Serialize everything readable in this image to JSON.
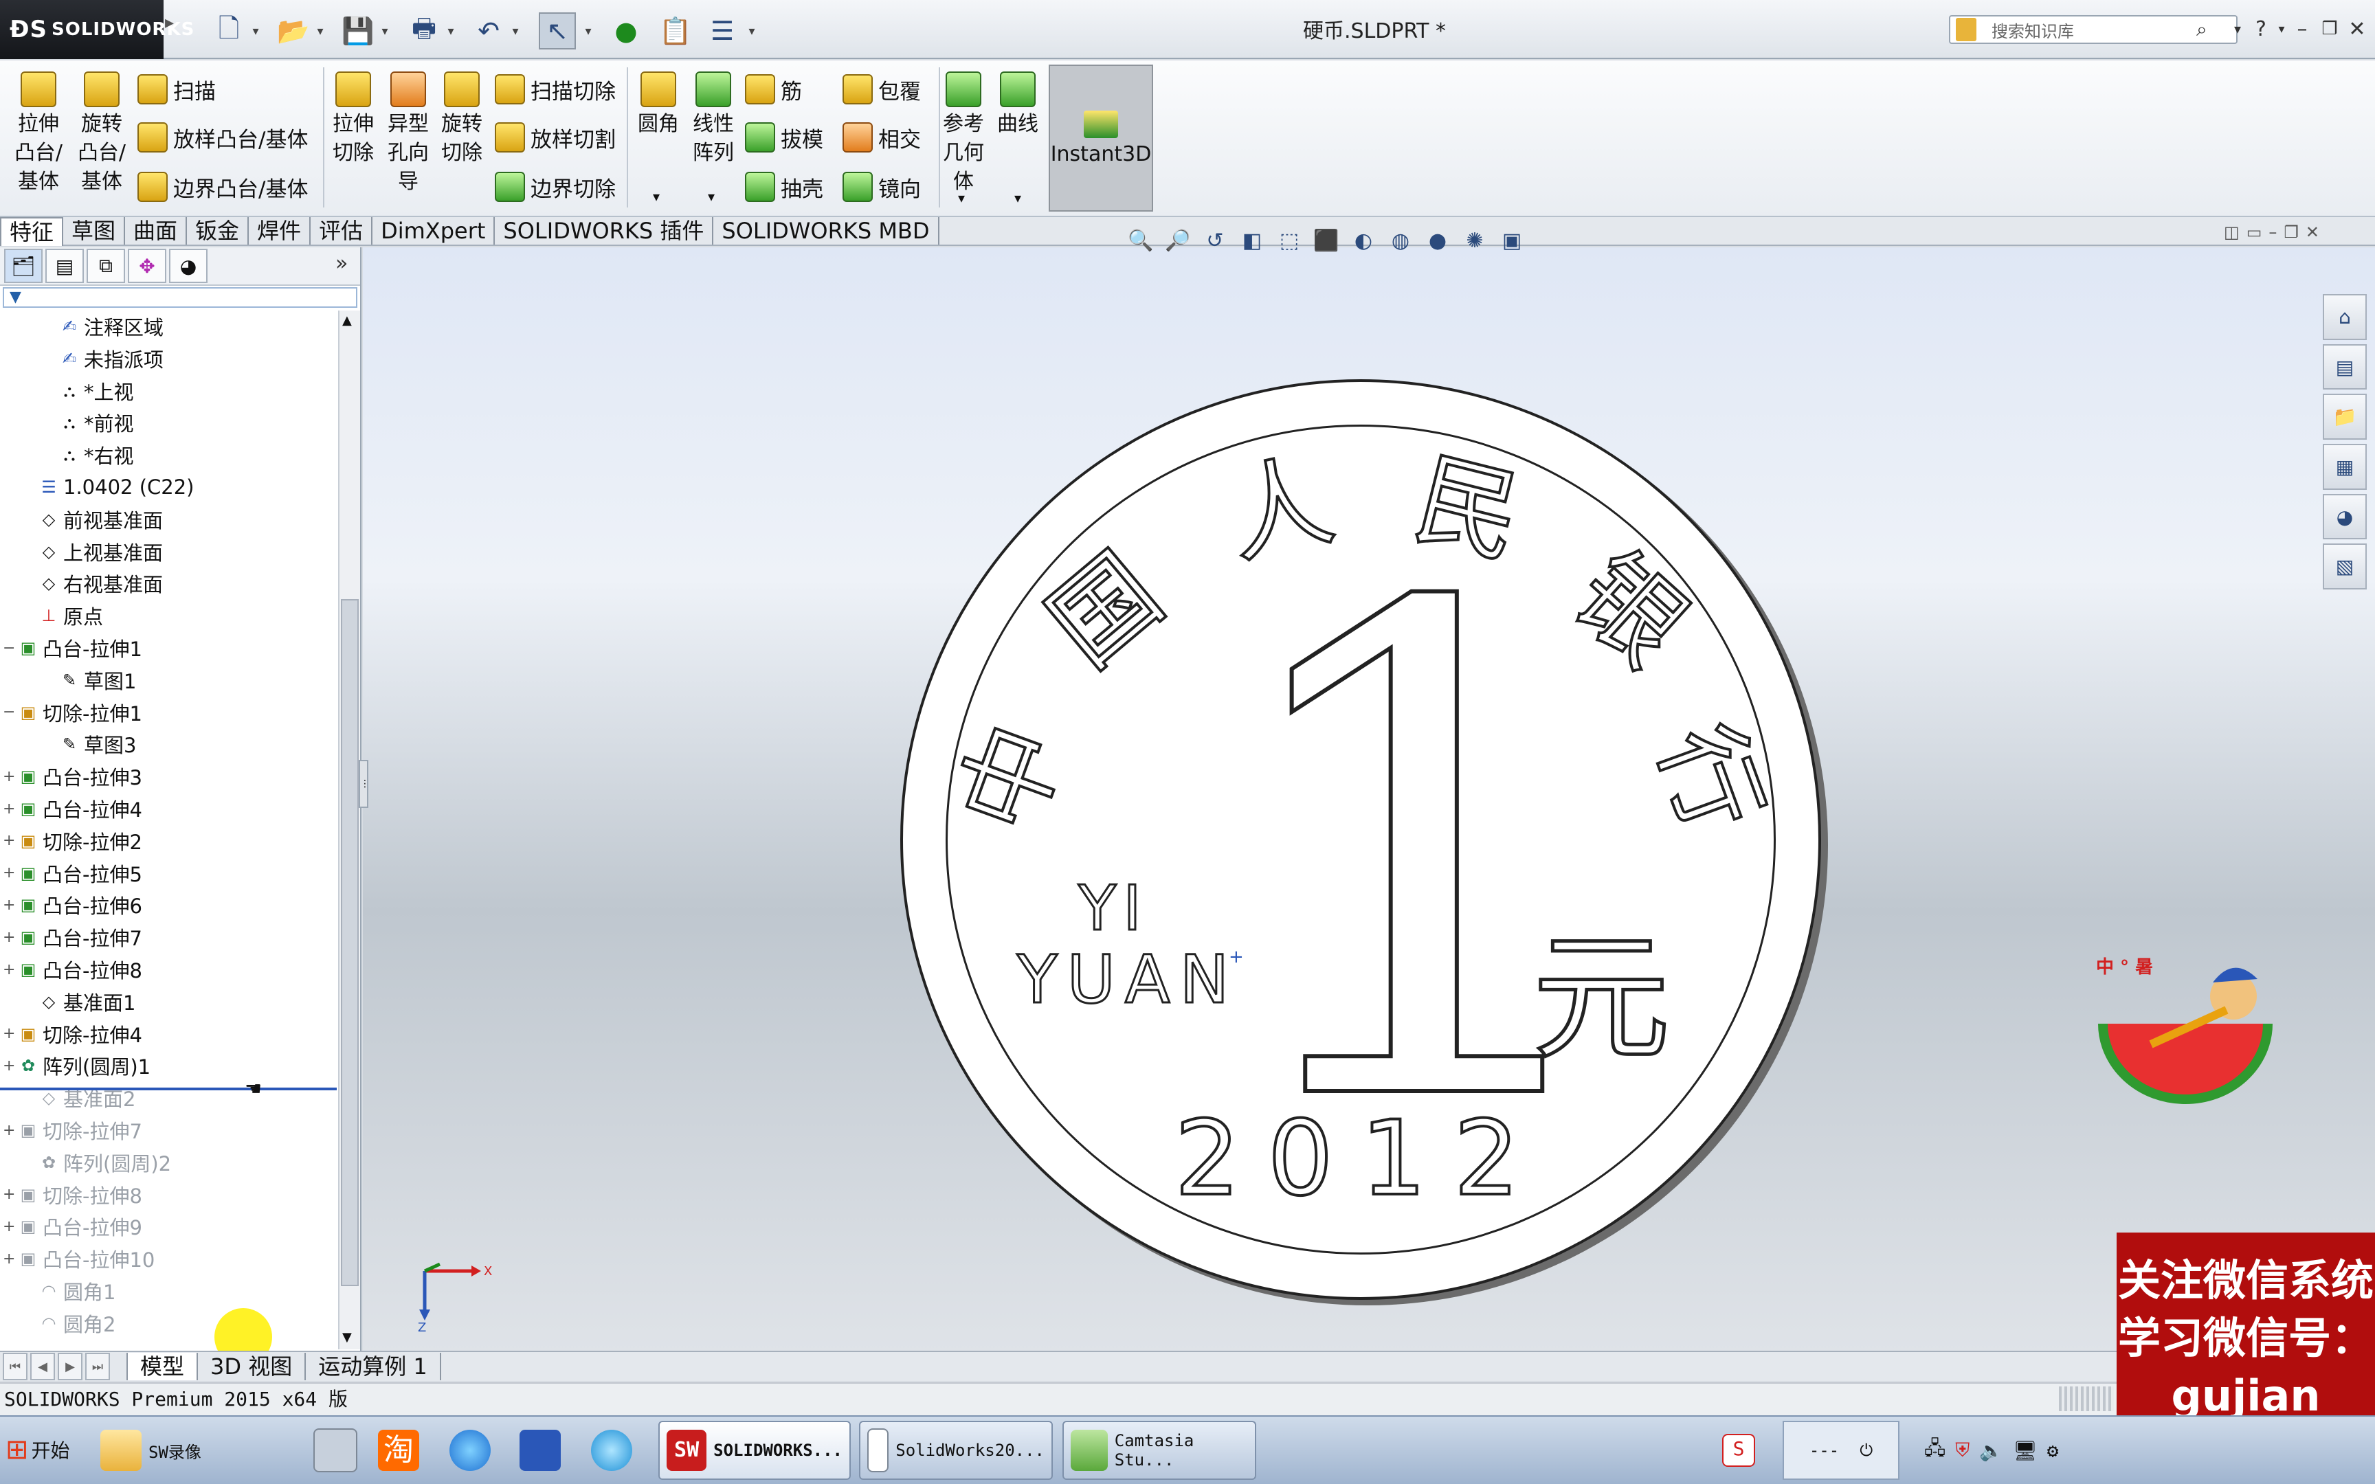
{
  "app": {
    "logo_text": "SOLIDWORKS",
    "doc_title": "硬币.SLDPRT *"
  },
  "search": {
    "placeholder": "搜索知识库"
  },
  "ribbon": {
    "extrude_boss": "拉伸\n凸台/\n基体",
    "revolve_boss": "旋转\n凸台/\n基体",
    "sweep": "扫描",
    "loft_boss": "放样凸台/基体",
    "boundary_boss": "边界凸台/基体",
    "extrude_cut": "拉伸\n切除",
    "hole_wizard": "异型\n孔向\n导",
    "revolve_cut": "旋转\n切除",
    "sweep_cut": "扫描切除",
    "loft_cut": "放样切割",
    "boundary_cut": "边界切除",
    "fillet": "圆角",
    "linear_pattern": "线性\n阵列",
    "rib": "筋",
    "draft": "拔模",
    "shell": "抽壳",
    "wrap": "包覆",
    "intersect": "相交",
    "mirror": "镜向",
    "ref_geometry": "参考\n几何\n体",
    "curves": "曲线",
    "instant3d": "Instant3D"
  },
  "tabs": [
    "特征",
    "草图",
    "曲面",
    "钣金",
    "焊件",
    "评估",
    "DimXpert",
    "SOLIDWORKS 插件",
    "SOLIDWORKS MBD"
  ],
  "tree": [
    {
      "label": "注释区域",
      "indent": 2,
      "dim": false,
      "exp": "",
      "icon": "annotation-icon"
    },
    {
      "label": "未指派项",
      "indent": 2,
      "dim": false,
      "exp": "",
      "icon": "annotation-icon"
    },
    {
      "label": "*上视",
      "indent": 2,
      "dim": false,
      "exp": "",
      "icon": "view-icon"
    },
    {
      "label": "*前视",
      "indent": 2,
      "dim": false,
      "exp": "",
      "icon": "view-icon"
    },
    {
      "label": "*右视",
      "indent": 2,
      "dim": false,
      "exp": "",
      "icon": "view-icon"
    },
    {
      "label": "1.0402 (C22)",
      "indent": 1,
      "dim": false,
      "exp": "",
      "icon": "material-icon"
    },
    {
      "label": "前视基准面",
      "indent": 1,
      "dim": false,
      "exp": "",
      "icon": "plane-icon"
    },
    {
      "label": "上视基准面",
      "indent": 1,
      "dim": false,
      "exp": "",
      "icon": "plane-icon"
    },
    {
      "label": "右视基准面",
      "indent": 1,
      "dim": false,
      "exp": "",
      "icon": "plane-icon"
    },
    {
      "label": "原点",
      "indent": 1,
      "dim": false,
      "exp": "",
      "icon": "origin-icon"
    },
    {
      "label": "凸台-拉伸1",
      "indent": 0,
      "dim": false,
      "exp": "−",
      "icon": "boss-extrude-icon"
    },
    {
      "label": "草图1",
      "indent": 2,
      "dim": false,
      "exp": "",
      "icon": "sketch-icon"
    },
    {
      "label": "切除-拉伸1",
      "indent": 0,
      "dim": false,
      "exp": "−",
      "icon": "cut-extrude-icon"
    },
    {
      "label": "草图3",
      "indent": 2,
      "dim": false,
      "exp": "",
      "icon": "sketch-icon"
    },
    {
      "label": "凸台-拉伸3",
      "indent": 0,
      "dim": false,
      "exp": "+",
      "icon": "boss-extrude-icon"
    },
    {
      "label": "凸台-拉伸4",
      "indent": 0,
      "dim": false,
      "exp": "+",
      "icon": "boss-extrude-icon"
    },
    {
      "label": "切除-拉伸2",
      "indent": 0,
      "dim": false,
      "exp": "+",
      "icon": "cut-extrude-icon"
    },
    {
      "label": "凸台-拉伸5",
      "indent": 0,
      "dim": false,
      "exp": "+",
      "icon": "boss-extrude-icon"
    },
    {
      "label": "凸台-拉伸6",
      "indent": 0,
      "dim": false,
      "exp": "+",
      "icon": "boss-extrude-icon"
    },
    {
      "label": "凸台-拉伸7",
      "indent": 0,
      "dim": false,
      "exp": "+",
      "icon": "boss-extrude-icon"
    },
    {
      "label": "凸台-拉伸8",
      "indent": 0,
      "dim": false,
      "exp": "+",
      "icon": "boss-extrude-icon"
    },
    {
      "label": "基准面1",
      "indent": 1,
      "dim": false,
      "exp": "",
      "icon": "plane-icon"
    },
    {
      "label": "切除-拉伸4",
      "indent": 0,
      "dim": false,
      "exp": "+",
      "icon": "cut-extrude-icon"
    },
    {
      "label": "阵列(圆周)1",
      "indent": 0,
      "dim": false,
      "exp": "+",
      "icon": "circular-pattern-icon"
    },
    {
      "label": "基准面2",
      "indent": 1,
      "dim": true,
      "exp": "",
      "icon": "plane-icon"
    },
    {
      "label": "切除-拉伸7",
      "indent": 0,
      "dim": true,
      "exp": "+",
      "icon": "cut-extrude-icon"
    },
    {
      "label": "阵列(圆周)2",
      "indent": 1,
      "dim": true,
      "exp": "",
      "icon": "circular-pattern-icon"
    },
    {
      "label": "切除-拉伸8",
      "indent": 0,
      "dim": true,
      "exp": "+",
      "icon": "cut-extrude-icon"
    },
    {
      "label": "凸台-拉伸9",
      "indent": 0,
      "dim": true,
      "exp": "+",
      "icon": "boss-extrude-icon"
    },
    {
      "label": "凸台-拉伸10",
      "indent": 0,
      "dim": true,
      "exp": "+",
      "icon": "boss-extrude-icon"
    },
    {
      "label": "圆角1",
      "indent": 1,
      "dim": true,
      "exp": "",
      "icon": "fillet-icon"
    },
    {
      "label": "圆角2",
      "indent": 1,
      "dim": true,
      "exp": "",
      "icon": "fillet-icon"
    }
  ],
  "coin": {
    "chars": [
      "中",
      "国",
      "人",
      "民",
      "银",
      "行"
    ],
    "yi": "YI",
    "yuan_en": "YUAN",
    "digit": "1",
    "yuan_cn": "元",
    "year": "2012"
  },
  "triad": {
    "x": "X",
    "z": "Z"
  },
  "model_tabs": [
    "模型",
    "3D 视图",
    "运动算例 1"
  ],
  "status": "SOLIDWORKS Premium 2015 x64 版",
  "watermark": {
    "text": "关注微信系统学习微信号：gujian teacher"
  },
  "taskbar": {
    "start": "开始",
    "items": [
      "SW录像",
      "SOLIDWORKS...",
      "SolidWorks20...",
      "Camtasia Stu..."
    ],
    "tray_text": "---"
  },
  "colors": {
    "accent": "#2a57b8",
    "watermark_bg": "#b10d0d",
    "highlight": "#fff000"
  }
}
